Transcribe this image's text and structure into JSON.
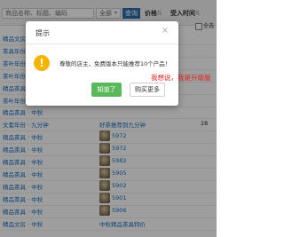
{
  "toolbar": {
    "search_placeholder": "商品名称、标题、编码",
    "category_value": "全部",
    "search_button": "查询",
    "sort_price": "价格",
    "sort_price_arrow": "⇅",
    "sort_favorites": "受入时间",
    "sort_favorites_arrow": "⇅",
    "check_all": "全选"
  },
  "rows": [
    {
      "name": "精品文房",
      "sku": "",
      "title": "",
      "count": ""
    },
    {
      "name": "茶具年份",
      "sku": "",
      "title": "",
      "count": ""
    },
    {
      "name": "茶叶年份",
      "sku": "",
      "title": "",
      "count": ""
    },
    {
      "name": "茶叶年份",
      "sku": "",
      "title": "",
      "count": ""
    },
    {
      "name": "精品茶具",
      "sku": "",
      "title": "",
      "count": ""
    },
    {
      "name": "茶叶年份",
      "sku": "",
      "title": "",
      "count": ""
    },
    {
      "name": "精品茶具 · 中秋",
      "sku": "",
      "title": "",
      "count": ""
    },
    {
      "name": "文套年份 · 九分钟",
      "sku": "",
      "title": "好茶推荐到九分钟",
      "count": "28"
    },
    {
      "name": "精品茶具 · 中秋",
      "sku": "5972",
      "title": "",
      "count": ""
    },
    {
      "name": "精品茶具 · 中秋",
      "sku": "5972",
      "title": "",
      "count": ""
    },
    {
      "name": "精品茶具 · 中秋",
      "sku": "5982",
      "title": "",
      "count": ""
    },
    {
      "name": "精品茶具 · 中秋",
      "sku": "5905",
      "title": "",
      "count": ""
    },
    {
      "name": "精品茶具 · 中秋",
      "sku": "5902",
      "title": "",
      "count": ""
    },
    {
      "name": "精品茶具 · 中秋",
      "sku": "5901",
      "title": "",
      "count": ""
    },
    {
      "name": "精品茶具 · 中秋",
      "sku": "5906",
      "title": "",
      "count": ""
    },
    {
      "name": "精品文房 · 中秋",
      "sku": "",
      "title": "中秋精品茶具特价",
      "count": ""
    }
  ],
  "dialog": {
    "title": "提示",
    "close_glyph": "×",
    "warn_glyph": "!",
    "message": "尊敬的店主，免费版本只能推荐10个产品！",
    "ok_button": "知道了",
    "buy_button": "购买更多"
  },
  "annotation": "我想说，我是升级版",
  "colors": {
    "accent": "#2a6fb0",
    "ok_button": "#5cb85c",
    "warning": "#f5b400",
    "annotation": "#e02020",
    "link": "#1a6ec0"
  },
  "icons": [
    "close-icon",
    "warning-icon",
    "caret-down-icon",
    "sort-icon"
  ]
}
